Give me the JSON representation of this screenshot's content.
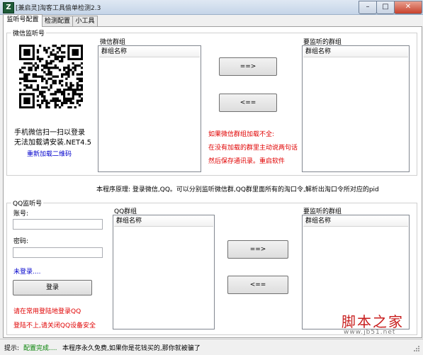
{
  "window": {
    "title": "[兼启灵]淘客工具偷单检测2.3",
    "minimize": "–",
    "maximize": "□",
    "close": "✕"
  },
  "tabs": [
    {
      "label": "监听号配置",
      "active": true
    },
    {
      "label": "检测配置",
      "active": false
    },
    {
      "label": "小工具",
      "active": false
    }
  ],
  "wechat": {
    "group_title": "微信监听号",
    "scan_text": "手机微信扫一扫以登录",
    "install_text": "无法加载请安装.NET4.5",
    "reload_link": "重新加载二维码",
    "groups_title": "微信群组",
    "groups_header": "群组名称",
    "monitored_title": "要监听的群组",
    "monitored_header": "群组名称",
    "add_button": "==>",
    "remove_button": "<==",
    "hint_1": "如果微信群组加载不全:",
    "hint_2": "在没有加载的群里主动说两句话",
    "hint_3": "然后保存通讯录。重启软件"
  },
  "principle_text": "本程序原理: 登录微信,QQ。可以分别监听微信群,QQ群里面所有的淘口令,解析出淘口令所对应的pid",
  "qq": {
    "group_title": "QQ监听号",
    "account_label": "账号:",
    "account_value": "",
    "password_label": "密码:",
    "password_value": "",
    "status": "未登录....",
    "login_button": "登录",
    "hint_1": "请在常用登陆地登录QQ",
    "hint_2": "登陆不上,请关闭QQ设备安全",
    "groups_title": "QQ群组",
    "groups_header": "群组名称",
    "monitored_title": "要监听的群组",
    "monitored_header": "群组名称",
    "add_button": "==>",
    "remove_button": "<=="
  },
  "statusbar": {
    "label": "提示:",
    "config_status": "配置完成....",
    "message": "本程序永久免费,如果你是花钱买的,那你就被骗了"
  },
  "watermark": {
    "text": "脚本之家",
    "url": "www.jb51.net"
  },
  "colors": {
    "hint_red": "#e00000",
    "link_blue": "#0000cc",
    "status_green": "#008000"
  }
}
